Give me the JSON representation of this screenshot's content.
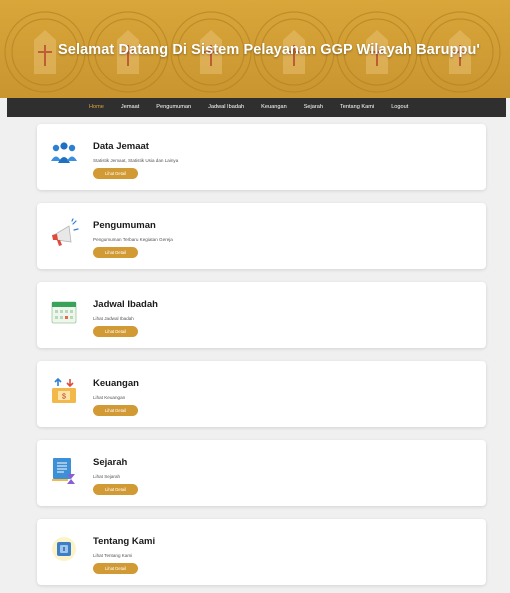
{
  "banner": {
    "title": "Selamat Datang Di Sistem Pelayanan GGP Wilayah Baruppu'"
  },
  "nav": {
    "items": [
      {
        "label": "Home",
        "active": true
      },
      {
        "label": "Jemaat"
      },
      {
        "label": "Pengumuman"
      },
      {
        "label": "Jadwal Ibadah"
      },
      {
        "label": "Keuangan"
      },
      {
        "label": "Sejarah"
      },
      {
        "label": "Tentang Kami"
      },
      {
        "label": "Logout"
      }
    ]
  },
  "cards": [
    {
      "title": "Data Jemaat",
      "desc": "Statistik Jemaat, Statistik Usia dan Lainya",
      "button": "Lihat Detail",
      "icon": "people-icon"
    },
    {
      "title": "Pengumuman",
      "desc": "Pengumuman Terbaru Kegiatan Gereja",
      "button": "Lihat Detail",
      "icon": "megaphone-icon"
    },
    {
      "title": "Jadwal Ibadah",
      "desc": "Lihat Jadwal Ibadah",
      "button": "Lihat Detail",
      "icon": "calendar-icon"
    },
    {
      "title": "Keuangan",
      "desc": "Lihat Keuangan",
      "button": "Lihat Detail",
      "icon": "finance-icon"
    },
    {
      "title": "Sejarah",
      "desc": "Lihat Sejarah",
      "button": "Lihat Detail",
      "icon": "history-book-icon"
    },
    {
      "title": "Tentang Kami",
      "desc": "Lihat Tentang Kami",
      "button": "Lihat Detail",
      "icon": "info-badge-icon"
    }
  ],
  "colors": {
    "accent": "#d29a35",
    "banner": "#d9a63a",
    "navbar": "#2f2f2f"
  }
}
